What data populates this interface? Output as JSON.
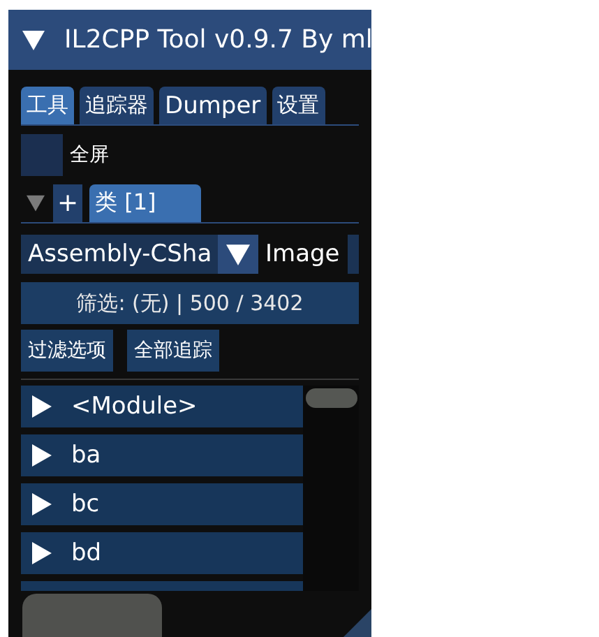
{
  "window": {
    "title": "IL2CPP Tool v0.9.7 By ml",
    "expanded": true
  },
  "tabs": [
    {
      "label": "工具",
      "selected": true
    },
    {
      "label": "追踪器",
      "selected": false
    },
    {
      "label": "Dumper",
      "selected": false
    },
    {
      "label": "设置",
      "selected": false
    }
  ],
  "fullscreen": {
    "label": "全屏",
    "checked": false
  },
  "class_section": {
    "expanded": true,
    "add_button": "+",
    "tabs": [
      {
        "label": "类 [1]",
        "selected": true
      }
    ]
  },
  "assembly_combo": {
    "value": "Assembly-CSha",
    "label": "Image"
  },
  "filter_status": "筛选: (无) | 500 / 3402",
  "buttons": [
    "过滤选项",
    "全部追踪"
  ],
  "class_list": [
    {
      "label": "<Module>",
      "expanded": false
    },
    {
      "label": "ba",
      "expanded": false
    },
    {
      "label": "bc",
      "expanded": false
    },
    {
      "label": "bd",
      "expanded": false
    }
  ]
}
